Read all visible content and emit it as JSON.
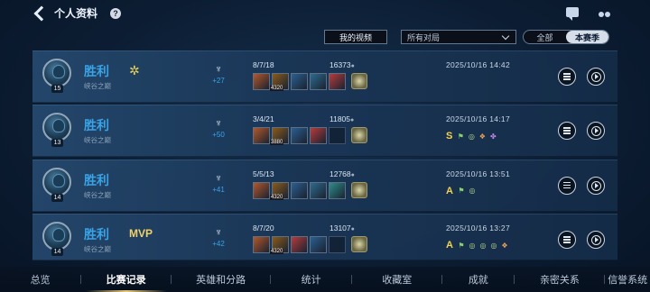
{
  "header": {
    "title": "个人资料",
    "help_label": "?"
  },
  "filters": {
    "video_button": "我的视频",
    "match_filter": "所有对局",
    "season_tabs": [
      "全部",
      "本赛季"
    ],
    "season_active": "本赛季"
  },
  "matches": [
    {
      "level": "15",
      "result": "胜利",
      "mode": "峡谷之巅",
      "badge": "spin",
      "score": "+27",
      "kda": "8/7/18",
      "gold": "16373",
      "time": "2025/10/16 14:42",
      "grade": "",
      "honors": [],
      "item_tag": "4320",
      "items": [
        "#b4572b",
        "#8a5a1a",
        "#2b5f90",
        "#2e6b8d",
        "#b63b3b"
      ]
    },
    {
      "level": "13",
      "result": "胜利",
      "mode": "峡谷之巅",
      "badge": "",
      "score": "+50",
      "kda": "3/4/21",
      "gold": "11805",
      "time": "2025/10/16 14:17",
      "grade": "S",
      "honors": [
        "flag",
        "target",
        "orange",
        "purple"
      ],
      "item_tag": "3880",
      "items": [
        "#b4572b",
        "#8a5a1a",
        "#2b5f90",
        "#b63b3b",
        "empty"
      ]
    },
    {
      "level": "14",
      "result": "胜利",
      "mode": "峡谷之巅",
      "badge": "",
      "score": "+41",
      "kda": "5/5/13",
      "gold": "12768",
      "time": "2025/10/16 13:51",
      "grade": "A",
      "honors": [
        "flag",
        "target"
      ],
      "item_tag": "4320",
      "items": [
        "#b4572b",
        "#8a5a1a",
        "#2b5f90",
        "#2e6b8d",
        "#2e8d8a"
      ]
    },
    {
      "level": "14",
      "result": "胜利",
      "mode": "峡谷之巅",
      "badge": "MVP",
      "score": "+42",
      "kda": "8/7/20",
      "gold": "13107",
      "time": "2025/10/16 13:27",
      "grade": "A",
      "honors": [
        "flag",
        "target",
        "target",
        "target",
        "orange"
      ],
      "item_tag": "4320",
      "items": [
        "#b4572b",
        "#8a5a1a",
        "#b63b3b",
        "#2b5f90",
        "empty"
      ]
    }
  ],
  "bottom_nav": {
    "tabs": [
      "总览",
      "比赛记录",
      "英雄和分路",
      "统计",
      "收藏室",
      "成就",
      "亲密关系",
      "信誉系统"
    ],
    "active": "比赛记录"
  },
  "colors": {
    "win_blue": "#3aa3e6",
    "grade_gold": "#f5d24f",
    "mvp_gold": "#f0d26a"
  }
}
